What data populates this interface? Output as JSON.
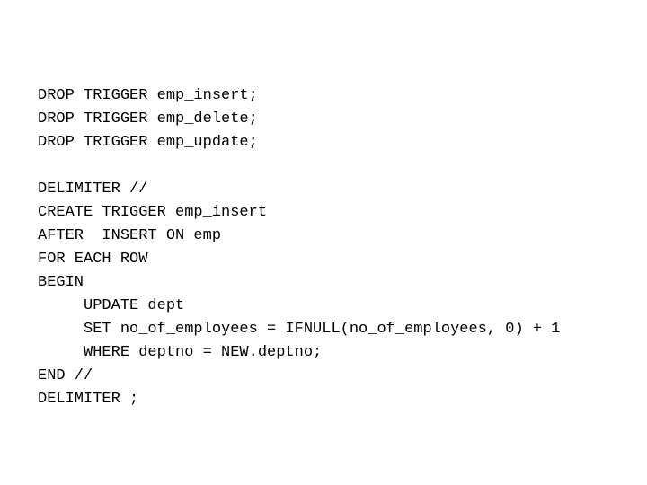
{
  "slide": {
    "background_color": "#ffffff",
    "text_color": "#000000",
    "code_lines": [
      {
        "text": "DROP TRIGGER emp_insert;"
      },
      {
        "text": "DROP TRIGGER emp_delete;"
      },
      {
        "text": "DROP TRIGGER emp_update;"
      },
      {
        "text": ""
      },
      {
        "text": "DELIMITER //"
      },
      {
        "text": "CREATE TRIGGER emp_insert"
      },
      {
        "text": "AFTER  INSERT ON emp"
      },
      {
        "text": "FOR EACH ROW"
      },
      {
        "text": "BEGIN"
      },
      {
        "text": "     UPDATE dept"
      },
      {
        "text": "     SET no_of_employees = IFNULL(no_of_employees, 0) + 1"
      },
      {
        "text": "     WHERE deptno = NEW.deptno;"
      },
      {
        "text": "END //"
      },
      {
        "text": "DELIMITER ;"
      }
    ]
  }
}
